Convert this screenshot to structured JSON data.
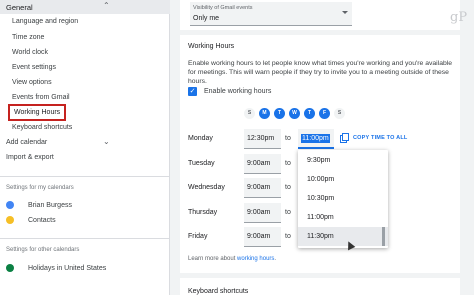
{
  "sidebar": {
    "header": "General",
    "items": [
      {
        "label": "Language and region"
      },
      {
        "label": "Time zone"
      },
      {
        "label": "World clock"
      },
      {
        "label": "Event settings"
      },
      {
        "label": "View options"
      },
      {
        "label": "Events from Gmail"
      },
      {
        "label": "Working Hours",
        "selected": true
      },
      {
        "label": "Keyboard shortcuts"
      }
    ],
    "add_calendar": "Add calendar",
    "import_export": "Import & export",
    "my_calendars_heading": "Settings for my calendars",
    "my_calendars": [
      {
        "name": "Brian Burgess",
        "color": "#4285f4"
      },
      {
        "name": "Contacts",
        "color": "#f6bf26"
      }
    ],
    "other_calendars_heading": "Settings for other calendars",
    "other_calendars": [
      {
        "name": "Holidays in United States",
        "color": "#0b8043"
      }
    ]
  },
  "visibility": {
    "label": "Visibility of Gmail events",
    "value": "Only me"
  },
  "working_hours": {
    "title": "Working Hours",
    "description": "Enable working hours to let people know what times you're working and you're available for meetings. This will warn people if they try to invite you to a meeting outside of these hours.",
    "enable_label": "Enable working hours",
    "enabled": true,
    "days": [
      {
        "letter": "S",
        "on": false
      },
      {
        "letter": "M",
        "on": true
      },
      {
        "letter": "T",
        "on": true
      },
      {
        "letter": "W",
        "on": true
      },
      {
        "letter": "T",
        "on": true
      },
      {
        "letter": "F",
        "on": true
      },
      {
        "letter": "S",
        "on": false
      }
    ],
    "rows": [
      {
        "day": "Monday",
        "start": "12:30pm",
        "to": "to",
        "end": "11:00pm"
      },
      {
        "day": "Tuesday",
        "start": "9:00am",
        "to": "to"
      },
      {
        "day": "Wednesday",
        "start": "9:00am",
        "to": "to"
      },
      {
        "day": "Thursday",
        "start": "9:00am",
        "to": "to"
      },
      {
        "day": "Friday",
        "start": "9:00am",
        "to": "to"
      }
    ],
    "copy_label": "COPY TIME TO ALL",
    "dropdown_options": [
      "9:30pm",
      "10:00pm",
      "10:30pm",
      "11:00pm",
      "11:30pm"
    ],
    "learn_prefix": "Learn more about",
    "learn_link": "working hours",
    "learn_suffix": "."
  },
  "keyboard_shortcuts_title": "Keyboard shortcuts",
  "logo_text": "gP"
}
